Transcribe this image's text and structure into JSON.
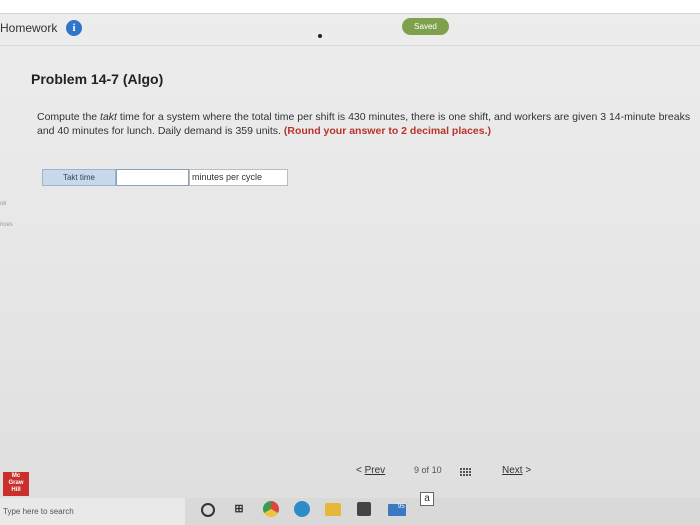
{
  "header": {
    "title": "Homework",
    "info_icon": "i",
    "saved_badge": "Saved"
  },
  "problem": {
    "title": "Problem 14-7 (Algo)",
    "question_part1": "Compute the ",
    "question_italic": "takt",
    "question_part2": " time for a system where the total time per shift is 430 minutes, there is one shift, and workers are given 3 14-minute breaks and 40 minutes for lunch. Daily demand is 359 units. ",
    "question_emphasis": "(Round your answer to 2 decimal places.)"
  },
  "answer": {
    "label": "Takt time",
    "value": "",
    "unit": "minutes per cycle"
  },
  "sidebar": {
    "item1": "ok",
    "item2": "nces"
  },
  "logo": {
    "line1": "Mc",
    "line2": "Graw",
    "line3": "Hill"
  },
  "navigation": {
    "prev_arrow": "<",
    "prev_label": "Prev",
    "page_current": "9",
    "page_of": "of",
    "page_total": "10",
    "next_label": "Next",
    "next_arrow": ">"
  },
  "taskbar": {
    "search_placeholder": "Type here to search",
    "word_letter": "a",
    "mail_count": "95"
  }
}
